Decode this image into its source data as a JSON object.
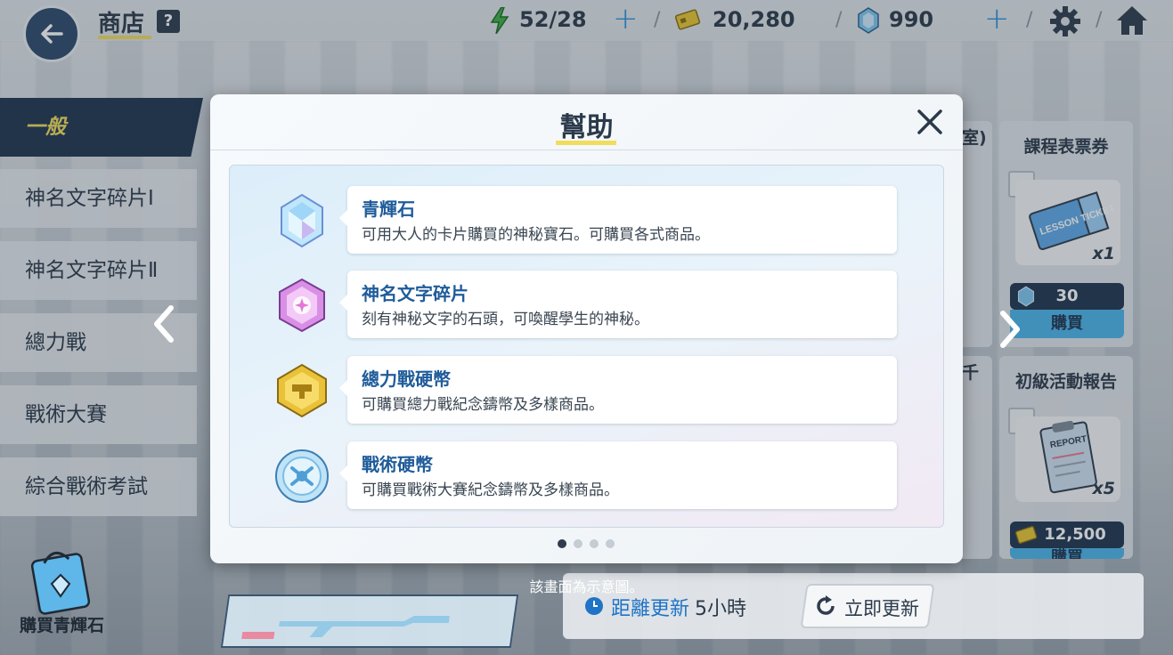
{
  "header": {
    "title": "商店",
    "help_icon": "?",
    "ap": "52/28",
    "credits": "20,280",
    "gems": "990",
    "icons": [
      "back-arrow-icon",
      "question-icon",
      "lightning-icon",
      "credit-icon",
      "gem-icon",
      "gear-icon",
      "home-icon"
    ]
  },
  "sidebar": {
    "items": [
      {
        "label": "一般",
        "active": true
      },
      {
        "label": "神名文字碎片Ⅰ"
      },
      {
        "label": "神名文字碎片Ⅱ"
      },
      {
        "label": "總力戰"
      },
      {
        "label": "戰術大賽"
      },
      {
        "label": "綜合戰術考試"
      }
    ]
  },
  "shop": {
    "cards": [
      {
        "title": "課程表票券",
        "qty": "x1",
        "price": "30",
        "buy": "購買",
        "art_text": "LESSON TICKET"
      },
      {
        "title": "初級活動報告",
        "qty": "x5",
        "price": "12,500",
        "buy": "購買",
        "art_text": "REPORT"
      }
    ],
    "partial_text_1": "室)",
    "partial_text_2": "千",
    "left_arrow": "‹",
    "right_arrow": "›"
  },
  "bottom": {
    "buy_gem_label": "購買青輝石",
    "refresh_label": "距離更新",
    "refresh_time": "5小時",
    "refresh_button": "立即更新",
    "caption": "該畫面為示意圖。"
  },
  "modal": {
    "title": "幫助",
    "close": "×",
    "items": [
      {
        "title": "青輝石",
        "desc": "可用大人的卡片購買的神秘寶石。可購買各式商品。",
        "icon": "pyroxene-icon"
      },
      {
        "title": "神名文字碎片",
        "desc": "刻有神秘文字的石頭，可喚醒學生的神秘。",
        "icon": "eligma-icon"
      },
      {
        "title": "總力戰硬幣",
        "desc": "可購買總力戰紀念鑄幣及多樣商品。",
        "icon": "raid-coin-icon"
      },
      {
        "title": "戰術硬幣",
        "desc": "可購買戰術大賽紀念鑄幣及多樣商品。",
        "icon": "arena-coin-icon"
      }
    ],
    "page_current": 1,
    "page_total": 4
  },
  "colors": {
    "accent_yellow": "#f2dc5d",
    "navy": "#1f3550",
    "link_blue": "#1f74c6",
    "buy_blue": "#4bb4ea"
  }
}
